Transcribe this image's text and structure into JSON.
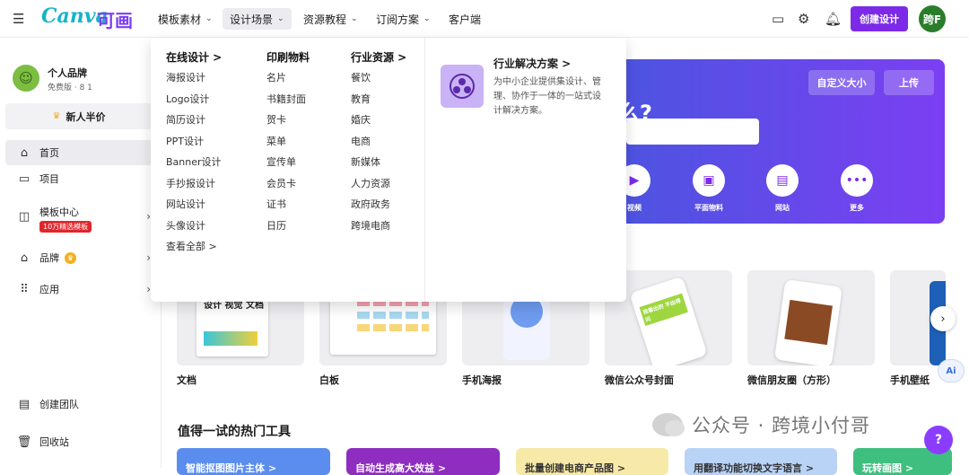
{
  "topbar": {
    "logo": "Canva",
    "logo_cn": "可画",
    "nav": [
      {
        "label": "模板素材"
      },
      {
        "label": "设计场景"
      },
      {
        "label": "资源教程"
      },
      {
        "label": "订阅方案"
      },
      {
        "label": "客户端"
      }
    ],
    "create_label": "创建设计",
    "avatar_text": "跨F"
  },
  "sidebar": {
    "user_name": "个人品牌",
    "user_sub": "免费版 · 8 1",
    "half_price": "新人半价",
    "items": [
      {
        "label": "首页"
      },
      {
        "label": "项目"
      },
      {
        "label": "模板中心",
        "badge": "10万精选模板"
      },
      {
        "label": "品牌"
      },
      {
        "label": "应用"
      }
    ],
    "bottom": [
      {
        "label": "创建团队"
      },
      {
        "label": "回收站"
      }
    ]
  },
  "banner": {
    "question": "么?",
    "custom_size": "自定义大小",
    "upload": "上传",
    "quick": [
      {
        "label": "视频",
        "icon": "video-icon"
      },
      {
        "label": "平面物料",
        "icon": "print-icon"
      },
      {
        "label": "网站",
        "icon": "website-icon"
      },
      {
        "label": "更多",
        "icon": "more-icon"
      }
    ]
  },
  "cards": [
    {
      "label": "文档",
      "thumb_text": "设计 视觉 文档"
    },
    {
      "label": "白板"
    },
    {
      "label": "手机海报"
    },
    {
      "label": "微信公众号封面",
      "thumb_text": "我看出的 不由得问"
    },
    {
      "label": "微信朋友圈（方形）"
    },
    {
      "label": "手机壁纸"
    }
  ],
  "hot_tools": {
    "title": "值得一试的热门工具",
    "items": [
      {
        "label": "智能抠图图片主体 >",
        "color": "#5b8def"
      },
      {
        "label": "自动生成高大效益 >",
        "color": "#8e2dbf"
      },
      {
        "label": "批量创建电商产品图 >",
        "color": "#f7e9a8"
      },
      {
        "label": "用翻译功能切换文字语言 >",
        "color": "#b9d3f7"
      },
      {
        "label": "玩转画图 >",
        "color": "#3fbf7f"
      }
    ]
  },
  "watermark": "公众号 · 跨境小付哥",
  "dropdown": {
    "columns": [
      {
        "header": "在线设计 >",
        "items": [
          "海报设计",
          "Logo设计",
          "简历设计",
          "PPT设计",
          "Banner设计",
          "手抄报设计",
          "网站设计",
          "头像设计",
          "查看全部 >"
        ]
      },
      {
        "header": "印刷物料",
        "items": [
          "名片",
          "书籍封面",
          "贺卡",
          "菜单",
          "宣传单",
          "会员卡",
          "证书",
          "日历"
        ]
      },
      {
        "header": "行业资源 >",
        "items": [
          "餐饮",
          "教育",
          "婚庆",
          "电商",
          "新媒体",
          "人力资源",
          "政府政务",
          "跨境电商"
        ]
      }
    ],
    "solution_title": "行业解决方案 >",
    "solution_desc": "为中小企业提供集设计、管理、协作于一体的一站式设计解决方案。"
  }
}
